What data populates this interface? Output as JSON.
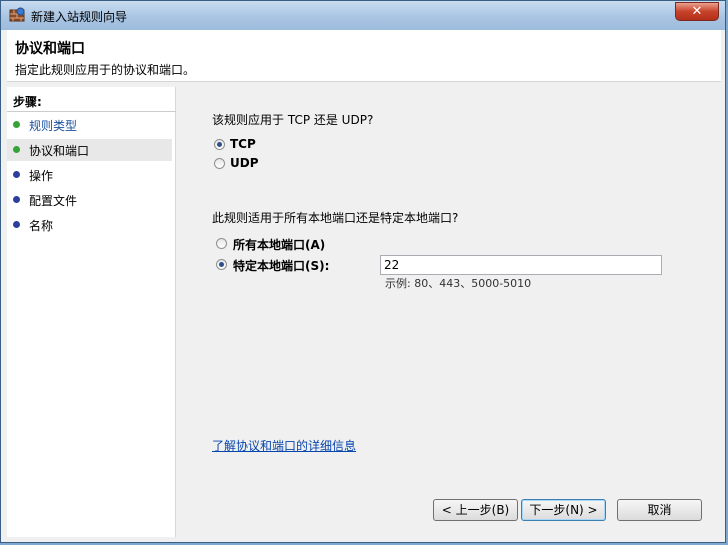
{
  "window": {
    "title": "新建入站规则向导",
    "close_label": "✕"
  },
  "header": {
    "title": "协议和端口",
    "subtitle": "指定此规则应用于的协议和端口。"
  },
  "steps": {
    "title": "步骤:",
    "items": [
      {
        "label": "规则类型",
        "state": "done"
      },
      {
        "label": "协议和端口",
        "state": "current"
      },
      {
        "label": "操作",
        "state": "pending"
      },
      {
        "label": "配置文件",
        "state": "pending"
      },
      {
        "label": "名称",
        "state": "pending"
      }
    ]
  },
  "protocol": {
    "question": "该规则应用于 TCP 还是 UDP?",
    "tcp_label": "TCP",
    "udp_label": "UDP",
    "selected": "TCP"
  },
  "ports": {
    "question": "此规则适用于所有本地端口还是特定本地端口?",
    "all_label": "所有本地端口(A)",
    "specific_label": "特定本地端口(S):",
    "selected": "specific",
    "value": "22",
    "example": "示例: 80、443、5000-5010"
  },
  "link": "了解协议和端口的详细信息",
  "buttons": {
    "back": "< 上一步(B)",
    "next": "下一步(N) >",
    "cancel": "取消"
  },
  "colors": {
    "done_dot": "#35a335",
    "pending_dot": "#2d3f9c",
    "link": "#0645ad"
  }
}
